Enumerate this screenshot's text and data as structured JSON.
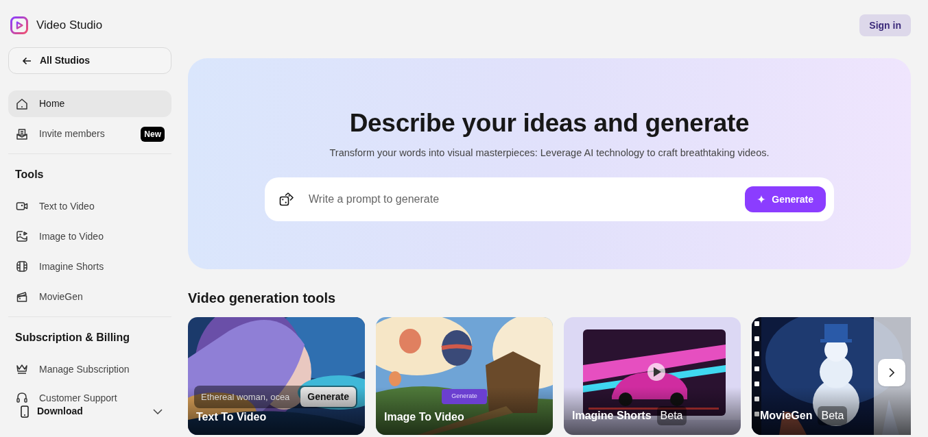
{
  "app": {
    "name": "Video Studio"
  },
  "header": {
    "sign_in": "Sign in"
  },
  "sidebar": {
    "back": "All Studios",
    "nav": [
      {
        "label": "Home",
        "selected": true
      },
      {
        "label": "Invite members",
        "selected": false,
        "badge": "New"
      }
    ],
    "sections": [
      {
        "title": "Tools",
        "items": [
          {
            "label": "Text to Video"
          },
          {
            "label": "Image to Video"
          },
          {
            "label": "Imagine Shorts"
          },
          {
            "label": "MovieGen"
          }
        ]
      },
      {
        "title": "Subscription & Billing",
        "items": [
          {
            "label": "Manage Subscription"
          },
          {
            "label": "Customer Support"
          }
        ]
      }
    ],
    "download": "Download"
  },
  "hero": {
    "title": "Describe your ideas and generate",
    "subtitle": "Transform your words into visual masterpieces: Leverage AI technology to craft breathtaking videos.",
    "prompt": {
      "placeholder": "Write a prompt to generate"
    },
    "button": "Generate"
  },
  "tools": {
    "title": "Video generation tools",
    "cards": [
      {
        "title": "Text To Video",
        "prompt": "Ethereal woman, ocea",
        "button": "Generate"
      },
      {
        "title": "Image To Video",
        "button": "Generate"
      },
      {
        "title": "Imagine Shorts",
        "badge": "Beta"
      },
      {
        "title": "MovieGen",
        "badge": "Beta"
      }
    ]
  }
}
